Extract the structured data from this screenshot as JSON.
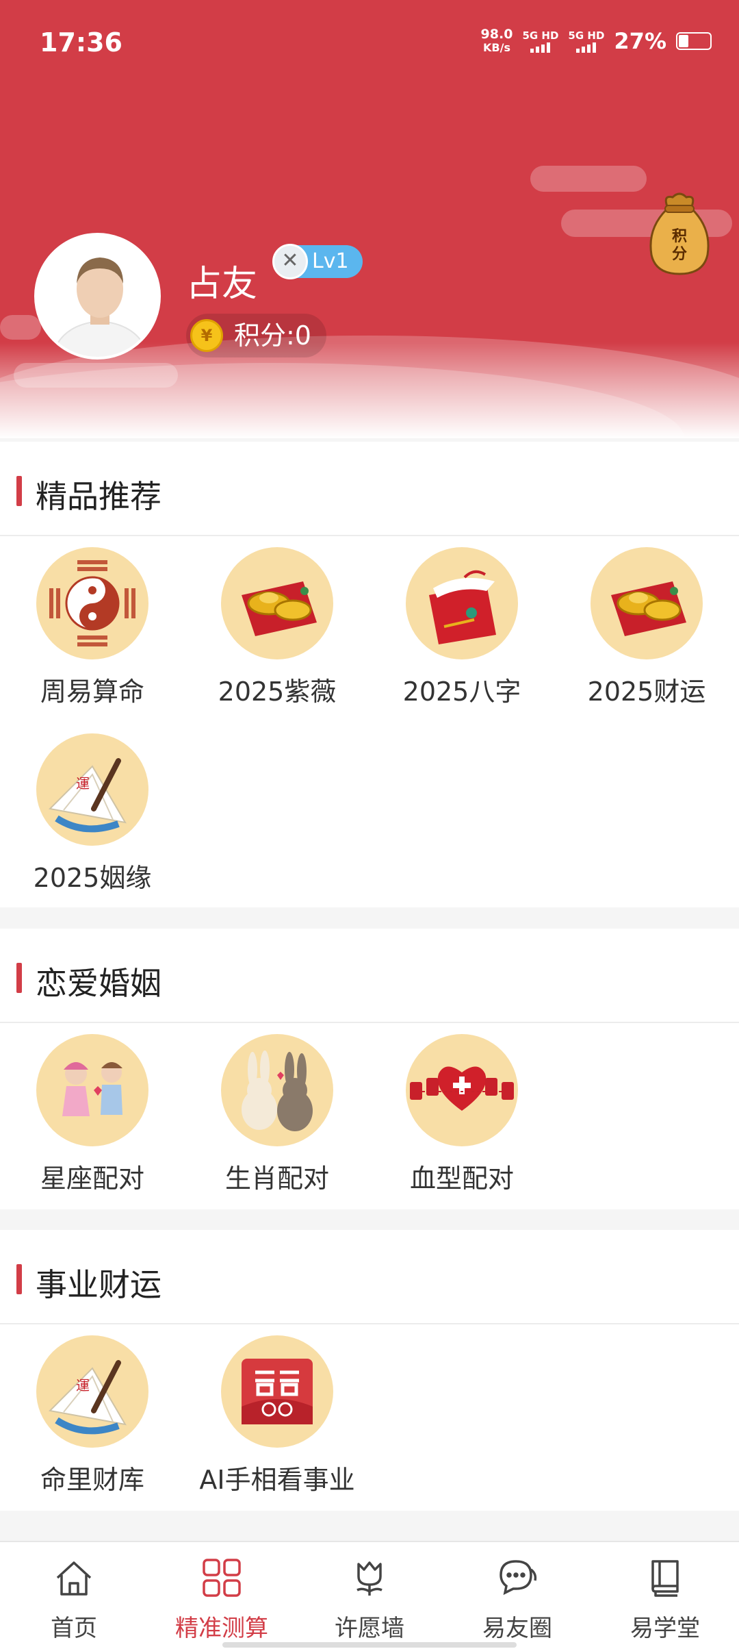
{
  "status": {
    "time": "17:36",
    "net_speed_value": "98.0",
    "net_speed_unit": "KB/s",
    "sim1": "5G HD",
    "sim2": "5G HD",
    "battery_pct": "27%"
  },
  "colors": {
    "accent": "#d23d47",
    "icon_bg": "#f8dea6",
    "level_badge": "#5bb6ee"
  },
  "profile": {
    "name": "占友",
    "level": "Lv1",
    "points": "积分:0",
    "coin_symbol": "¥",
    "bag_text": "积分"
  },
  "sections": [
    {
      "title": "精品推荐",
      "items": [
        {
          "label": "周易算命",
          "icon": "yin-yang-bagua-icon"
        },
        {
          "label": "2025紫薇",
          "icon": "gold-ingot-icon"
        },
        {
          "label": "2025八字",
          "icon": "red-envelope-icon"
        },
        {
          "label": "2025财运",
          "icon": "gold-ingot-icon"
        },
        {
          "label": "2025姻缘",
          "icon": "fan-brush-icon"
        }
      ]
    },
    {
      "title": "恋爱婚姻",
      "items": [
        {
          "label": "星座配对",
          "icon": "couple-icon"
        },
        {
          "label": "生肖配对",
          "icon": "rabbits-icon"
        },
        {
          "label": "血型配对",
          "icon": "heart-blood-icon"
        }
      ]
    },
    {
      "title": "事业财运",
      "items": [
        {
          "label": "命里财库",
          "icon": "fan-brush-icon"
        },
        {
          "label": "AI手相看事业",
          "icon": "double-happiness-icon"
        }
      ]
    }
  ],
  "tabs": [
    {
      "label": "首页",
      "icon": "home-icon"
    },
    {
      "label": "精准测算",
      "icon": "grid-icon",
      "active": true
    },
    {
      "label": "许愿墙",
      "icon": "tulip-icon"
    },
    {
      "label": "易友圈",
      "icon": "chat-icon"
    },
    {
      "label": "易学堂",
      "icon": "book-icon"
    }
  ]
}
